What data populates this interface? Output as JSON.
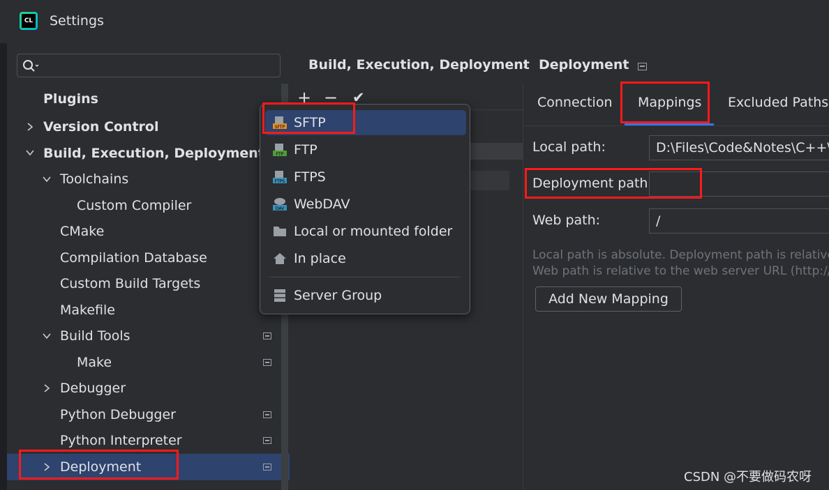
{
  "window": {
    "title": "Settings",
    "logo_text": "CL"
  },
  "search": {
    "placeholder": ""
  },
  "sidebar": {
    "items": [
      {
        "label": "Plugins"
      },
      {
        "label": "Version Control"
      },
      {
        "label": "Build, Execution, Deployment"
      },
      {
        "label": "Toolchains"
      },
      {
        "label": "Custom Compiler"
      },
      {
        "label": "CMake"
      },
      {
        "label": "Compilation Database"
      },
      {
        "label": "Custom Build Targets"
      },
      {
        "label": "Makefile"
      },
      {
        "label": "Build Tools"
      },
      {
        "label": "Make"
      },
      {
        "label": "Debugger"
      },
      {
        "label": "Python Debugger"
      },
      {
        "label": "Python Interpreter"
      },
      {
        "label": "Deployment"
      }
    ]
  },
  "breadcrumb": {
    "parent": "Build, Execution, Deployment",
    "separator": "›",
    "current": "Deployment"
  },
  "toolbar": {
    "add": "+",
    "remove": "−",
    "check": "✔"
  },
  "popup": {
    "items": [
      {
        "label": "SFTP",
        "icon": "sftp-icon",
        "badge": "SFTP"
      },
      {
        "label": "FTP",
        "icon": "ftp-icon",
        "badge": "FTP"
      },
      {
        "label": "FTPS",
        "icon": "ftps-icon",
        "badge": "FTPS"
      },
      {
        "label": "WebDAV",
        "icon": "webdav-icon",
        "badge": "DAV"
      },
      {
        "label": "Local or mounted folder",
        "icon": "folder-icon"
      },
      {
        "label": "In place",
        "icon": "home-icon"
      },
      {
        "label": "Server Group",
        "icon": "server-group-icon"
      }
    ]
  },
  "tabs": [
    {
      "label": "Connection"
    },
    {
      "label": "Mappings"
    },
    {
      "label": "Excluded Paths"
    }
  ],
  "mappings": {
    "local_path_label": "Local path:",
    "local_path_value": "D:\\Files\\Code&Notes\\C++\\",
    "deployment_path_label": "Deployment path:",
    "deployment_path_value": "",
    "web_path_label": "Web path:",
    "web_path_value": "/",
    "hint_line1": "Local path is absolute. Deployment path is relative",
    "hint_line2": "Web path is relative to the web server URL (http://",
    "add_button": "Add New Mapping"
  },
  "watermark": "CSDN @不要做码农呀",
  "colors": {
    "selection": "#2e436e",
    "accent": "#3574f0",
    "annotation": "#ff1a1a",
    "background": "#2b2d30"
  }
}
